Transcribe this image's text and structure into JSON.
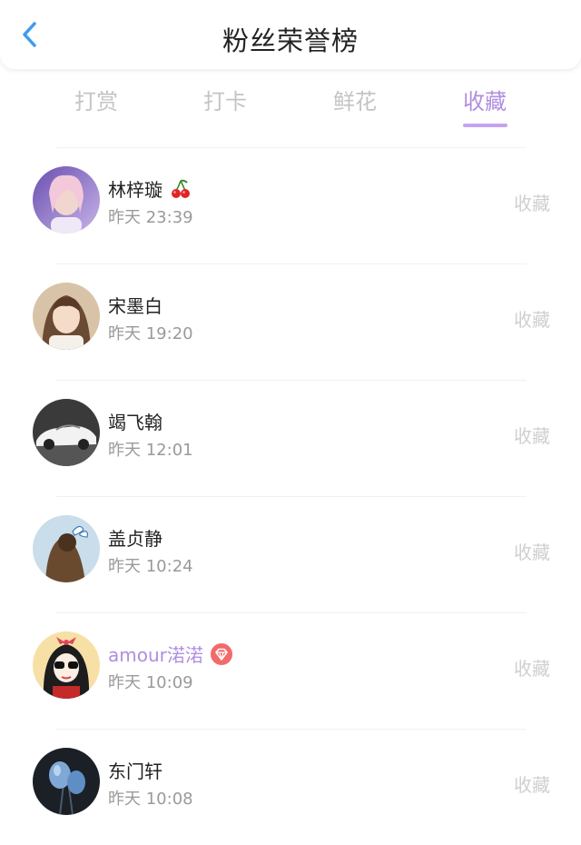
{
  "header": {
    "title": "粉丝荣誉榜"
  },
  "tabs": [
    {
      "label": "打赏"
    },
    {
      "label": "打卡"
    },
    {
      "label": "鲜花"
    },
    {
      "label": "收藏"
    }
  ],
  "active_tab": "收藏",
  "colors": {
    "accent": "#b08ee0",
    "back": "#3b9cf0",
    "muted": "#9a9a9a"
  },
  "rows": [
    {
      "name": "林梓璇",
      "badge": "cherry-icon",
      "time": "昨天 23:39",
      "action": "收藏"
    },
    {
      "name": "宋墨白",
      "time": "昨天 19:20",
      "action": "收藏"
    },
    {
      "name": "竭飞翰",
      "time": "昨天 12:01",
      "action": "收藏"
    },
    {
      "name": "盖贞静",
      "time": "昨天 10:24",
      "action": "收藏"
    },
    {
      "name": "amour渃渃",
      "badge": "diamond-vip-icon",
      "time": "昨天 10:09",
      "action": "收藏"
    },
    {
      "name": "东门轩",
      "time": "昨天 10:08",
      "action": "收藏"
    }
  ]
}
